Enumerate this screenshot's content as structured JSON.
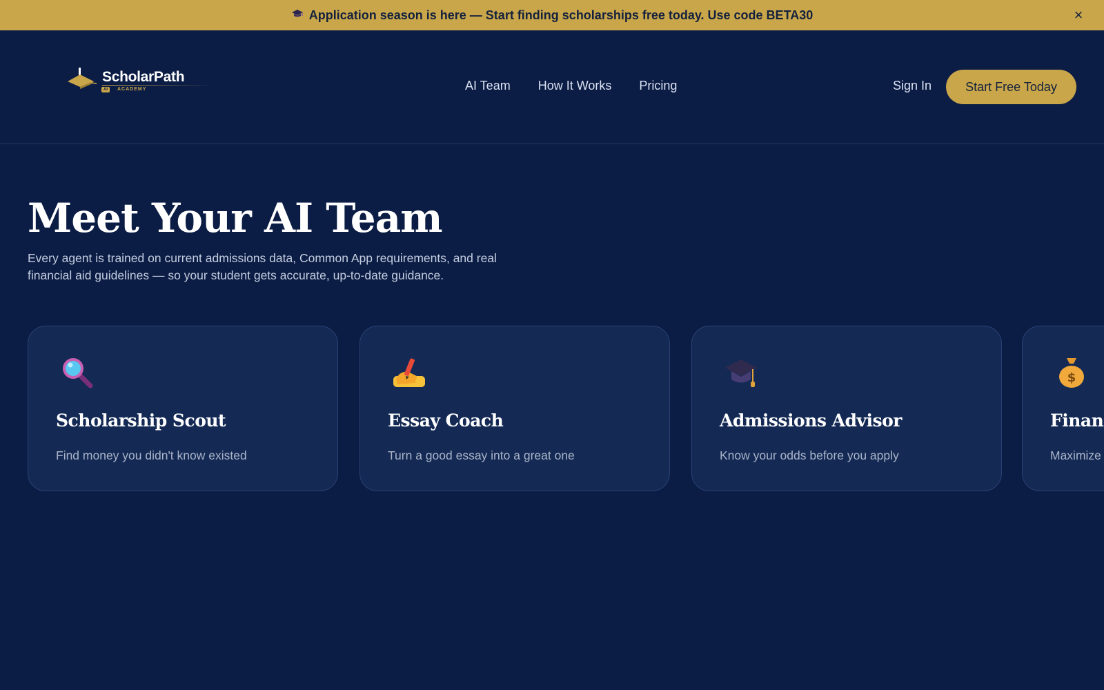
{
  "banner": {
    "icon": "graduation-cap-icon",
    "text": "Application season is here — Start finding scholarships free today. Use code BETA30",
    "close_icon": "close-icon"
  },
  "logo": {
    "name": "ScholarPath",
    "badge": "AI",
    "tagline": "ACADEMY"
  },
  "nav": {
    "items": [
      "AI Team",
      "How It Works",
      "Pricing"
    ]
  },
  "auth": {
    "sign_in": "Sign In",
    "cta": "Start Free Today"
  },
  "hero": {
    "title": "Meet Your AI Team",
    "subtitle": "Every agent is trained on current admissions data, Common App requirements, and real financial aid guidelines — so your student gets accurate, up-to-date guidance."
  },
  "agents": [
    {
      "icon": "magnifying-glass-icon",
      "title": "Scholarship Scout",
      "desc": "Find money you didn't know existed"
    },
    {
      "icon": "writing-hand-icon",
      "title": "Essay Coach",
      "desc": "Turn a good essay into a great one"
    },
    {
      "icon": "graduation-cap-icon",
      "title": "Admissions Advisor",
      "desc": "Know your odds before you apply"
    },
    {
      "icon": "money-bag-icon",
      "title": "Financ",
      "desc": "Maximize"
    }
  ],
  "colors": {
    "background": "#0c1d45",
    "accent": "#c9a64a",
    "card": "#142a55"
  }
}
